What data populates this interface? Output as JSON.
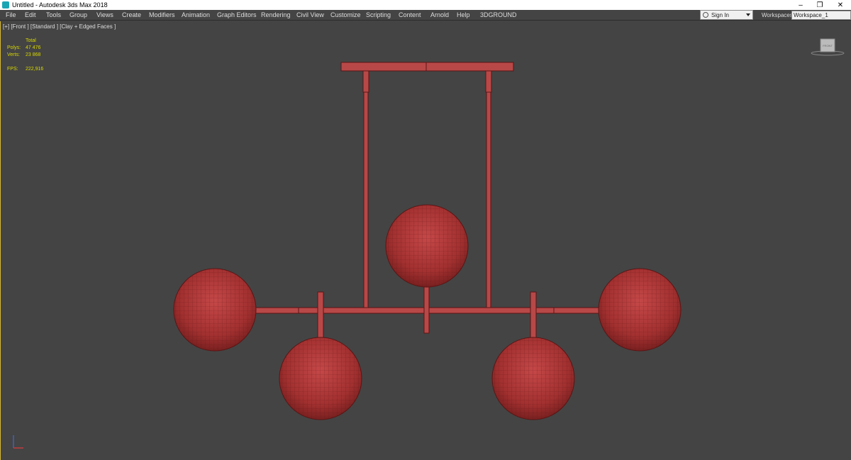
{
  "window": {
    "title": "Untitled - Autodesk 3ds Max 2018",
    "minimize": "–",
    "restore": "❐",
    "close": "✕"
  },
  "menu": {
    "items": [
      "File",
      "Edit",
      "Tools",
      "Group",
      "Views",
      "Create",
      "Modifiers",
      "Animation",
      "Graph Editors",
      "Rendering",
      "Civil View",
      "Customize",
      "Scripting",
      "Content",
      "Arnold",
      "Help",
      "3DGROUND"
    ]
  },
  "signin": {
    "label": "Sign In"
  },
  "workspaces": {
    "label": "Workspaces:",
    "value": "Workspace_1"
  },
  "viewport": {
    "label": "[+] [Front ] [Standard ] [Clay + Edged Faces ]",
    "stats": {
      "header": "Total",
      "polys_label": "Polys:",
      "polys": "47 476",
      "verts_label": "Verts:",
      "verts": "23 868",
      "fps_label": "FPS:",
      "fps": "222,916"
    },
    "viewcube_label": "FRONT"
  },
  "colors": {
    "mesh": "#b03a3a",
    "wire": "#5a1515",
    "background": "#444444",
    "stats": "#d8d800",
    "border": "#d8b830"
  }
}
